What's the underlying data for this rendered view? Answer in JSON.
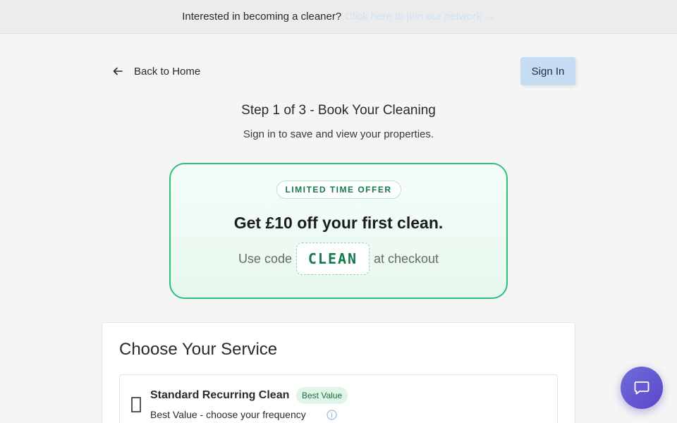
{
  "banner": {
    "text": "Interested in becoming a cleaner?",
    "link_text": "Click here to join our network →"
  },
  "header": {
    "back_label": "Back to Home",
    "signin_label": "Sign In"
  },
  "step": {
    "title": "Step 1 of 3 - Book Your Cleaning",
    "subtitle": "Sign in to save and view your properties."
  },
  "offer": {
    "badge": "LIMITED TIME OFFER",
    "headline": "Get £10 off your first clean.",
    "prefix": "Use code",
    "code": "CLEAN",
    "suffix": "at checkout",
    "accent_color": "#2fbf7a"
  },
  "service": {
    "title": "Choose Your Service",
    "options": [
      {
        "name": "Standard Recurring Clean",
        "badge": "Best Value",
        "description": "Best Value - choose your frequency",
        "icon": "broken-glyph-icon"
      }
    ]
  },
  "chat": {
    "icon": "chat-bubble-icon",
    "color": "#6f6ddd"
  }
}
